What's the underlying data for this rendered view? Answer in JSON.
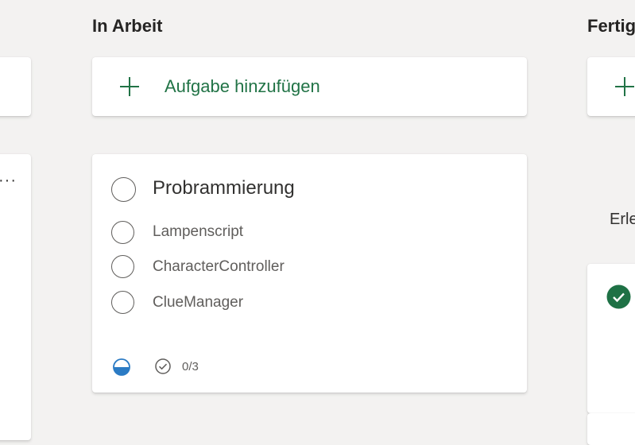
{
  "columns": {
    "in_progress": {
      "title": "In Arbeit",
      "add_task_label": "Aufgabe hinzufügen",
      "task": {
        "title": "Probrammierung",
        "checklist": [
          {
            "label": "Lampenscript",
            "done": false
          },
          {
            "label": "CharacterController",
            "done": false
          },
          {
            "label": "ClueManager",
            "done": false
          }
        ],
        "progress_icon": "half-filled-circle-icon",
        "checklist_count": "0/3"
      }
    },
    "done": {
      "title": "Fertig",
      "section_label": "Erledigt"
    },
    "left_partial": {
      "more_icon": "ellipsis-icon"
    }
  },
  "colors": {
    "accent": "#217346",
    "progress_blue": "#2b7bc4",
    "check_green": "#1e7145"
  }
}
